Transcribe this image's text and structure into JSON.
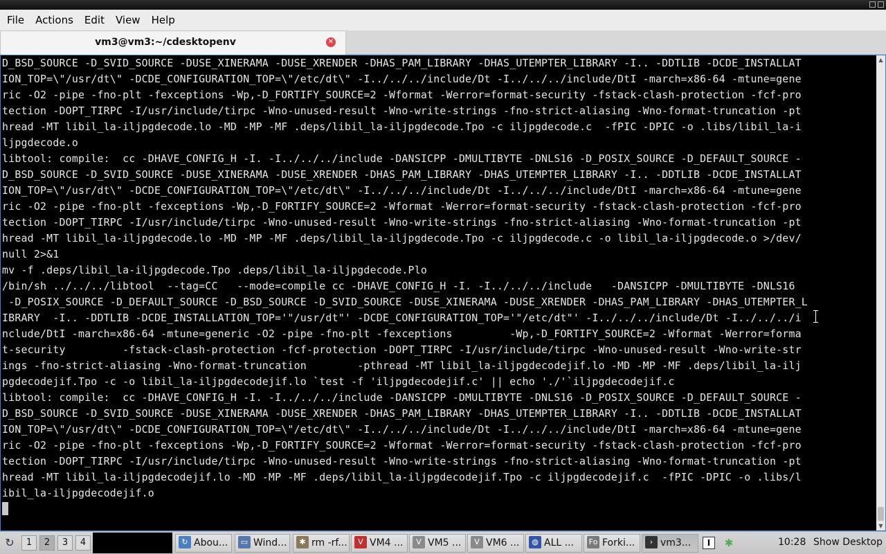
{
  "menu": [
    "File",
    "Actions",
    "Edit",
    "View",
    "Help"
  ],
  "tab": {
    "title": "vm3@vm3:~/cdesktopenv",
    "close_glyph": "✕"
  },
  "terminal": {
    "lines": [
      "D_BSD_SOURCE -D_SVID_SOURCE -DUSE_XINERAMA -DUSE_XRENDER -DHAS_PAM_LIBRARY -DHAS_UTEMPTER_LIBRARY -I.. -DDTLIB -DCDE_INSTALLAT",
      "ION_TOP=\\\"/usr/dt\\\" -DCDE_CONFIGURATION_TOP=\\\"/etc/dt\\\" -I../../../include/Dt -I../../../include/DtI -march=x86-64 -mtune=gene",
      "ric -O2 -pipe -fno-plt -fexceptions -Wp,-D_FORTIFY_SOURCE=2 -Wformat -Werror=format-security -fstack-clash-protection -fcf-pro",
      "tection -DOPT_TIRPC -I/usr/include/tirpc -Wno-unused-result -Wno-write-strings -fno-strict-aliasing -Wno-format-truncation -pt",
      "hread -MT libil_la-iljpgdecode.lo -MD -MP -MF .deps/libil_la-iljpgdecode.Tpo -c iljpgdecode.c  -fPIC -DPIC -o .libs/libil_la-i",
      "ljpgdecode.o",
      "libtool: compile:  cc -DHAVE_CONFIG_H -I. -I../../../include -DANSICPP -DMULTIBYTE -DNLS16 -D_POSIX_SOURCE -D_DEFAULT_SOURCE -",
      "D_BSD_SOURCE -D_SVID_SOURCE -DUSE_XINERAMA -DUSE_XRENDER -DHAS_PAM_LIBRARY -DHAS_UTEMPTER_LIBRARY -I.. -DDTLIB -DCDE_INSTALLAT",
      "ION_TOP=\\\"/usr/dt\\\" -DCDE_CONFIGURATION_TOP=\\\"/etc/dt\\\" -I../../../include/Dt -I../../../include/DtI -march=x86-64 -mtune=gene",
      "ric -O2 -pipe -fno-plt -fexceptions -Wp,-D_FORTIFY_SOURCE=2 -Wformat -Werror=format-security -fstack-clash-protection -fcf-pro",
      "tection -DOPT_TIRPC -I/usr/include/tirpc -Wno-unused-result -Wno-write-strings -fno-strict-aliasing -Wno-format-truncation -pt",
      "hread -MT libil_la-iljpgdecode.lo -MD -MP -MF .deps/libil_la-iljpgdecode.Tpo -c iljpgdecode.c -o libil_la-iljpgdecode.o >/dev/",
      "null 2>&1",
      "mv -f .deps/libil_la-iljpgdecode.Tpo .deps/libil_la-iljpgdecode.Plo",
      "/bin/sh ../../../libtool  --tag=CC   --mode=compile cc -DHAVE_CONFIG_H -I. -I../../../include   -DANSICPP -DMULTIBYTE -DNLS16",
      " -D_POSIX_SOURCE -D_DEFAULT_SOURCE -D_BSD_SOURCE -D_SVID_SOURCE -DUSE_XINERAMA -DUSE_XRENDER -DHAS_PAM_LIBRARY -DHAS_UTEMPTER_L",
      "IBRARY  -I.. -DDTLIB -DCDE_INSTALLATION_TOP='\"/usr/dt\"' -DCDE_CONFIGURATION_TOP='\"/etc/dt\"' -I../../../include/Dt -I../../../i",
      "nclude/DtI -march=x86-64 -mtune=generic -O2 -pipe -fno-plt -fexceptions         -Wp,-D_FORTIFY_SOURCE=2 -Wformat -Werror=forma",
      "t-security         -fstack-clash-protection -fcf-protection -DOPT_TIRPC -I/usr/include/tirpc -Wno-unused-result -Wno-write-str",
      "ings -fno-strict-aliasing -Wno-format-truncation        -pthread -MT libil_la-iljpgdecodejif.lo -MD -MP -MF .deps/libil_la-ilj",
      "pgdecodejif.Tpo -c -o libil_la-iljpgdecodejif.lo `test -f 'iljpgdecodejif.c' || echo './'`iljpgdecodejif.c",
      "libtool: compile:  cc -DHAVE_CONFIG_H -I. -I../../../include -DANSICPP -DMULTIBYTE -DNLS16 -D_POSIX_SOURCE -D_DEFAULT_SOURCE -",
      "D_BSD_SOURCE -D_SVID_SOURCE -DUSE_XINERAMA -DUSE_XRENDER -DHAS_PAM_LIBRARY -DHAS_UTEMPTER_LIBRARY -I.. -DDTLIB -DCDE_INSTALLAT",
      "ION_TOP=\\\"/usr/dt\\\" -DCDE_CONFIGURATION_TOP=\\\"/etc/dt\\\" -I../../../include/Dt -I../../../include/DtI -march=x86-64 -mtune=gene",
      "ric -O2 -pipe -fno-plt -fexceptions -Wp,-D_FORTIFY_SOURCE=2 -Wformat -Werror=format-security -fstack-clash-protection -fcf-pro",
      "tection -DOPT_TIRPC -I/usr/include/tirpc -Wno-unused-result -Wno-write-strings -fno-strict-aliasing -Wno-format-truncation -pt",
      "hread -MT libil_la-iljpgdecodejif.lo -MD -MP -MF .deps/libil_la-iljpgdecodejif.Tpo -c iljpgdecodejif.c  -fPIC -DPIC -o .libs/l",
      "ibil_la-iljpgdecodejif.o"
    ]
  },
  "taskbar": {
    "workspaces": [
      "1",
      "2",
      "3",
      "4"
    ],
    "active_workspace": "2",
    "tasks": [
      {
        "label": "Abou...",
        "icon": "about-icon",
        "glyph": "↻",
        "color": "#4a7fc0"
      },
      {
        "label": "Wind...",
        "icon": "window-icon",
        "glyph": "▭",
        "color": "#5577aa"
      },
      {
        "label": "rm -rf...",
        "icon": "terminal-bug-icon",
        "glyph": "✱",
        "color": "#8a7a5a"
      },
      {
        "label": "VM4 ...",
        "icon": "vm-icon",
        "glyph": "V",
        "color": "#c03030"
      },
      {
        "label": "VM5 ...",
        "icon": "vm-icon",
        "glyph": "V",
        "color": "#8a8a8a"
      },
      {
        "label": "VM6 ...",
        "icon": "vm-icon",
        "glyph": "V",
        "color": "#8a8a8a"
      },
      {
        "label": "ALL ...",
        "icon": "globe-icon",
        "glyph": "◍",
        "color": "#3355aa"
      },
      {
        "label": "Forki...",
        "icon": "fo-app-icon",
        "glyph": "Fo",
        "color": "#7a7a7a"
      },
      {
        "label": "vm3...",
        "icon": "terminal-icon",
        "glyph": "›",
        "color": "#333333"
      }
    ],
    "active_task": "vm3...",
    "clock": "10:28",
    "show_desktop": "Show Desktop"
  },
  "scroll_position": 1.0
}
